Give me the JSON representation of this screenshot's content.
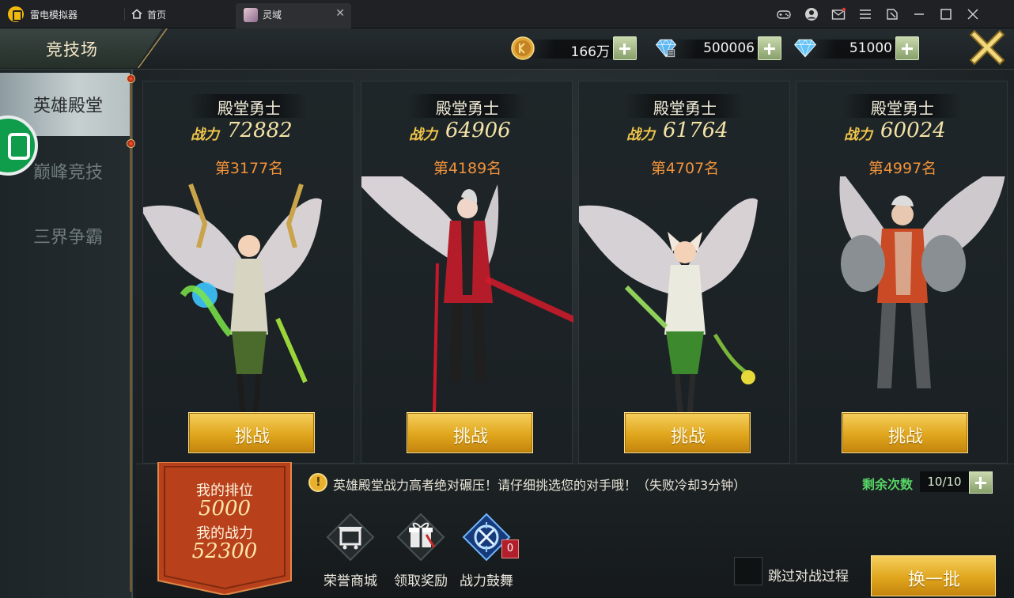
{
  "window": {
    "app_name": "雷电模拟器",
    "tabs": [
      {
        "label": "首页",
        "icon": "home-icon"
      },
      {
        "label": "灵域",
        "icon": "game-avatar-icon"
      }
    ],
    "controls": [
      "gamepad-icon",
      "account-icon",
      "mail-icon",
      "menu-icon",
      "shrink-icon",
      "minimize-icon",
      "maximize-icon",
      "close-icon"
    ]
  },
  "header": {
    "title": "竞技场",
    "currencies": [
      {
        "icon": "gold-coin-icon",
        "value": "166万"
      },
      {
        "icon": "bound-diamond-icon",
        "value": "500006"
      },
      {
        "icon": "diamond-icon",
        "value": "51000"
      }
    ]
  },
  "sidebar": {
    "items": [
      {
        "label": "英雄殿堂",
        "active": true
      },
      {
        "label": "巅峰竞技",
        "active": false
      },
      {
        "label": "三界争霸",
        "active": false
      }
    ]
  },
  "opponents": [
    {
      "name": "殿堂勇士",
      "power_label": "战力",
      "power": "72882",
      "rank": "第3177名",
      "button": "挑战",
      "figure": "winged-female-mage"
    },
    {
      "name": "殿堂勇士",
      "power_label": "战力",
      "power": "64906",
      "rank": "第4189名",
      "button": "挑战",
      "figure": "winged-swordsman"
    },
    {
      "name": "殿堂勇士",
      "power_label": "战力",
      "power": "61764",
      "rank": "第4707名",
      "button": "挑战",
      "figure": "winged-fox-girl"
    },
    {
      "name": "殿堂勇士",
      "power_label": "战力",
      "power": "60024",
      "rank": "第4997名",
      "button": "挑战",
      "figure": "winged-armored-warrior"
    }
  ],
  "my_info": {
    "rank_label": "我的排位",
    "rank_value": "5000",
    "power_label": "我的战力",
    "power_value": "52300"
  },
  "notice": "英雄殿堂战力高者绝对碾压！请仔细挑选您的对手哦！（失败冷却3分钟）",
  "remaining": {
    "label": "剩余次数",
    "value": "10/10"
  },
  "features": [
    {
      "label": "荣誉商城",
      "icon": "honor-shop-icon"
    },
    {
      "label": "领取奖励",
      "icon": "gift-reward-icon"
    },
    {
      "label": "战力鼓舞",
      "icon": "power-inspire-icon",
      "badge": "0"
    }
  ],
  "skip": {
    "label": "跳过对战过程",
    "checked": false
  },
  "refresh_button": "换一批",
  "colors": {
    "accent_gold": "#e0a61d",
    "rank_orange": "#f2923a",
    "remain_green": "#57d465",
    "active_tab": "#c7d0d1"
  }
}
